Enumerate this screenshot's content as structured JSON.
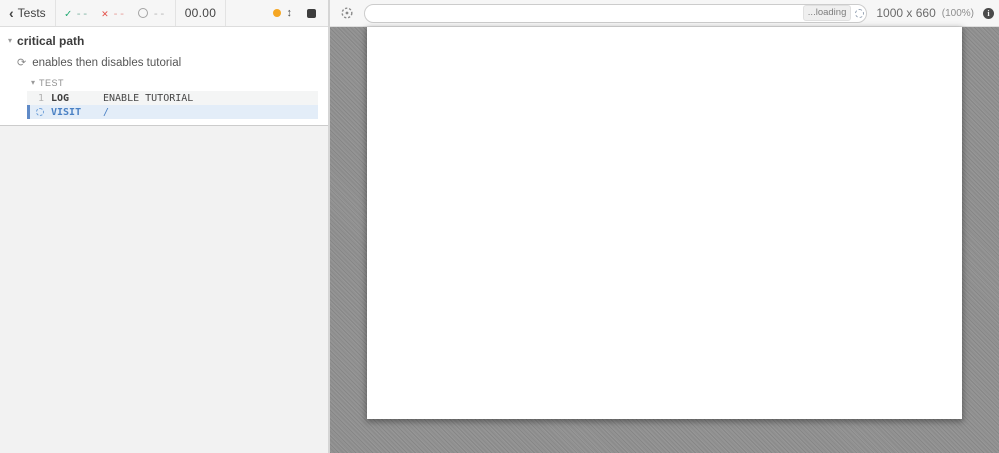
{
  "reporter": {
    "header": {
      "back_label": "Tests",
      "stats": {
        "passed_value": "--",
        "failed_value": "--",
        "pending_value": "--"
      },
      "timer_value": "00.00"
    },
    "suite_title": "critical path",
    "test_title": "enables then disables tutorial",
    "attempt_label": "TEST",
    "commands": [
      {
        "number": "1",
        "method": "LOG",
        "message": "ENABLE TUTORIAL",
        "state": "passed"
      },
      {
        "number": "",
        "method": "VISIT",
        "message": "/",
        "state": "running"
      }
    ]
  },
  "runner": {
    "url_bar": {
      "value": "",
      "loading_label": "...loading"
    },
    "viewport": {
      "size_label": "1000 x 660",
      "scale_label": "(100%)",
      "info_label": "i"
    }
  },
  "icons": {
    "back_chevron": "‹",
    "passed_check": "✓",
    "failed_x": "✕",
    "arrows_v": "↕",
    "suite_caret": "▾",
    "attempt_caret": "▾",
    "running_arrows": "⟳"
  },
  "colors": {
    "passed_green": "#1fa971",
    "failed_red": "#e45049",
    "pending_gray": "#a3a3a3",
    "command_blue": "#4a81c4",
    "command_row_highlight": "#e3edf8",
    "accent_orange": "#f5a623",
    "viewport_background": "#919191"
  }
}
